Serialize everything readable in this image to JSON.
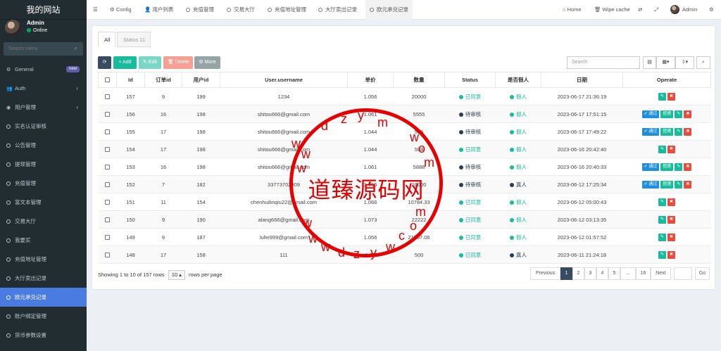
{
  "sidebar": {
    "brand": "我的网站",
    "user": {
      "name": "Admin",
      "status": "Online"
    },
    "search_placeholder": "Search menu",
    "items": [
      {
        "label": "General",
        "icon": "gears-icon",
        "badge": "new"
      },
      {
        "label": "Auth",
        "icon": "users-icon",
        "chevron": "‹"
      },
      {
        "label": "用户管理",
        "icon": "user-circle-icon",
        "chevron": "‹"
      },
      {
        "label": "实名认证审核",
        "icon": "circle-icon"
      },
      {
        "label": "公告管理",
        "icon": "circle-icon"
      },
      {
        "label": "提现管理",
        "icon": "circle-icon"
      },
      {
        "label": "充值管理",
        "icon": "circle-icon"
      },
      {
        "label": "富文本管理",
        "icon": "circle-icon"
      },
      {
        "label": "交易大厅",
        "icon": "circle-icon"
      },
      {
        "label": "我要买",
        "icon": "circle-icon"
      },
      {
        "label": "充值地址管理",
        "icon": "circle-icon"
      },
      {
        "label": "大厅卖出记录",
        "icon": "circle-icon"
      },
      {
        "label": "欧元承兑记录",
        "icon": "circle-icon",
        "active": true
      },
      {
        "label": "账户绑定管理",
        "icon": "circle-icon"
      },
      {
        "label": "货币参数设置",
        "icon": "circle-icon"
      }
    ]
  },
  "topbar": {
    "menu_icon": "☰",
    "tabs": [
      "Config",
      "用户列表",
      "充值管理",
      "交易大厅",
      "充值地址管理",
      "大厅卖出记录",
      "欧元承兑记录"
    ],
    "home": "Home",
    "wipe": "Wipe cache",
    "admin": "Admin"
  },
  "content": {
    "tabs": [
      "All",
      "Status 11"
    ],
    "toolbar": {
      "add": "Add",
      "edit": "Edit",
      "delete": "Delete",
      "more": "More",
      "search_placeholder": "Search"
    },
    "columns": [
      "Id",
      "订单id",
      "用户id",
      "User.username",
      "单价",
      "数量",
      "Status",
      "是否假人",
      "日期",
      "Operate"
    ],
    "rows": [
      {
        "id": "157",
        "order": "9",
        "uid": "199",
        "user": "1234",
        "price": "1.056",
        "qty": "20000",
        "status": "已同意",
        "fake": "假人",
        "date": "2023-06-17 21:36:19",
        "pending": false
      },
      {
        "id": "156",
        "order": "16",
        "uid": "198",
        "user": "shitou666@gmail.com",
        "price": "1.061",
        "qty": "5555",
        "status": "待审核",
        "fake": "假人",
        "date": "2023-06-17 17:51:15",
        "pending": true
      },
      {
        "id": "155",
        "order": "17",
        "uid": "198",
        "user": "shitou666@gmail.com",
        "price": "1.044",
        "qty": "555",
        "status": "待审核",
        "fake": "假人",
        "date": "2023-06-17 17:49:22",
        "pending": true
      },
      {
        "id": "154",
        "order": "17",
        "uid": "198",
        "user": "shitou666@gmail.com",
        "price": "1.044",
        "qty": "588",
        "status": "已同意",
        "fake": "假人",
        "date": "2023-06-16 20:42:40",
        "pending": false
      },
      {
        "id": "153",
        "order": "16",
        "uid": "198",
        "user": "shitou666@gmail.com",
        "price": "1.061",
        "qty": "5888",
        "status": "待审核",
        "fake": "假人",
        "date": "2023-06-16 20:40:33",
        "pending": true
      },
      {
        "id": "152",
        "order": "7",
        "uid": "182",
        "user": "33773702909",
        "price": "1.066",
        "qty": "10000",
        "status": "待审核",
        "fake": "真人",
        "date": "2023-06-12 17:25:34",
        "pending": true
      },
      {
        "id": "151",
        "order": "11",
        "uid": "154",
        "user": "chenhuilinqiu22@gmail.com",
        "price": "1.066",
        "qty": "10784.33",
        "status": "已同意",
        "fake": "假人",
        "date": "2023-06-12 05:00:43",
        "pending": false
      },
      {
        "id": "150",
        "order": "9",
        "uid": "190",
        "user": "alang666@gmail.com",
        "price": "1.073",
        "qty": "22222",
        "status": "已同意",
        "fake": "假人",
        "date": "2023-06-12 03:13:35",
        "pending": false
      },
      {
        "id": "149",
        "order": "9",
        "uid": "187",
        "user": "lufei999@gmail.com",
        "price": "1.056",
        "qty": "21507.06",
        "status": "已同意",
        "fake": "假人",
        "date": "2023-06-12 01:57:52",
        "pending": false
      },
      {
        "id": "148",
        "order": "17",
        "uid": "158",
        "user": "111",
        "price": "1.05",
        "qty": "500",
        "status": "已同意",
        "fake": "真人",
        "date": "2023-06-11 21:24:18",
        "pending": false
      }
    ],
    "ops": {
      "pass": "通过",
      "reject": "拒绝"
    },
    "footer": {
      "showing": "Showing 1 to 10 of 157 rows",
      "page_size": "10",
      "per_page": "rows per page"
    },
    "pager": [
      "Previous",
      "1",
      "2",
      "3",
      "4",
      "5",
      "...",
      "16",
      "Next"
    ],
    "go": "Go"
  },
  "watermark": {
    "title": "道臻源码网",
    "chars": [
      "w",
      "w",
      "w",
      ".",
      "d",
      "z",
      "y",
      "m",
      "w",
      ".",
      "c",
      "o",
      "m"
    ]
  },
  "colors": {
    "sidebar": "#222d32",
    "active": "#4a7be0",
    "green": "#18bc9c",
    "dark": "#2c3e50",
    "danger": "#e74c3c",
    "primary": "#1e8edd",
    "watermark": "#e60000"
  }
}
